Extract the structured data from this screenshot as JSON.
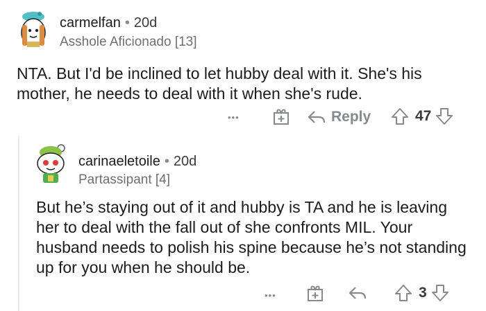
{
  "comments": [
    {
      "username": "carmelfan",
      "separator": "•",
      "age": "20d",
      "flair": "Asshole Aficionado [13]",
      "text": "NTA.  But I'd be inclined to let hubby deal with it.  She's his mother, he needs to deal with it when she's rude.",
      "actions": {
        "more": "•••",
        "award_icon": "gift-icon",
        "reply": "Reply",
        "votes": "47"
      }
    },
    {
      "username": "carinaeletoile",
      "separator": "•",
      "age": "20d",
      "flair": "Partassipant [4]",
      "text": "But he’s staying out of it and hubby is TA and he is leaving her to deal with the fall out of she confronts MIL. Your husband needs to polish his spine because he’s not standing up for you when he should be.",
      "actions": {
        "more": "•••",
        "award_icon": "gift-icon",
        "reply_icon": "reply-arrow-icon",
        "votes": "3"
      }
    }
  ]
}
